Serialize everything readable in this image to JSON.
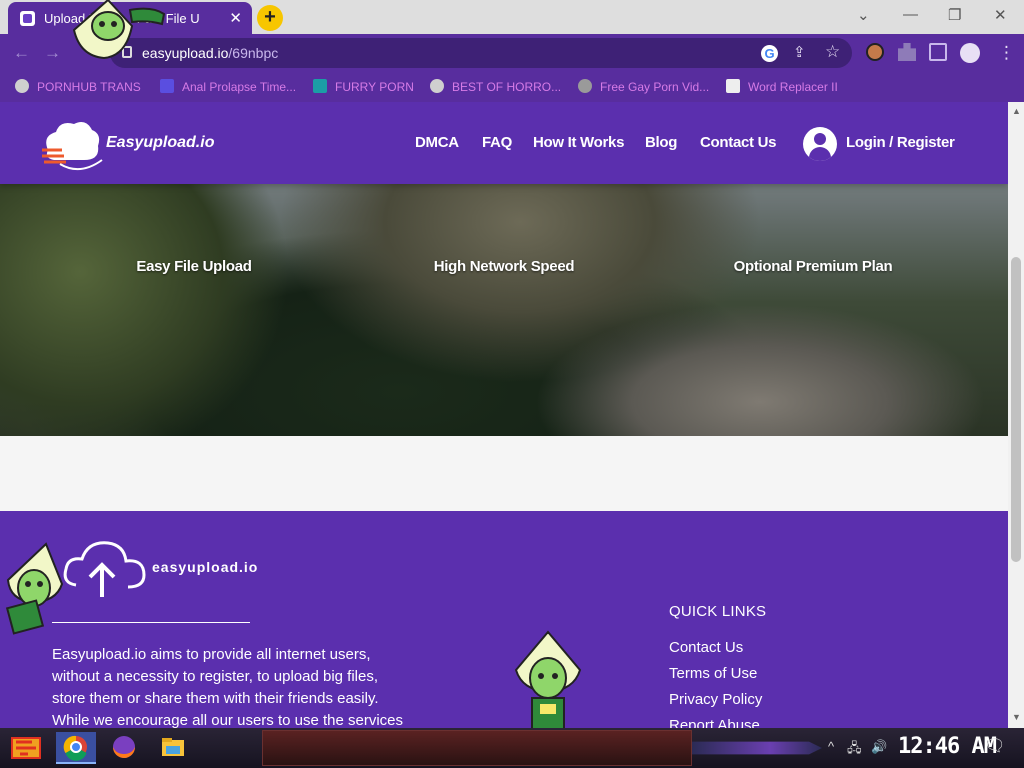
{
  "browser": {
    "tab_title": "Upload Files Fast File U",
    "tab_title_visible": "Upload F",
    "tab_title_visible_right": "Fast File U",
    "tab_close": "✕",
    "new_tab": "+",
    "window_controls": {
      "minimize": "—",
      "restore": "❐",
      "close": "✕",
      "tabsearch": "⌄"
    },
    "url_host": "easyupload.io",
    "url_path": "/69nbpc",
    "back": "←",
    "forward": "→",
    "reload": "C",
    "bookmarks": [
      {
        "label": "PORNHUB TRANS"
      },
      {
        "label": "Anal Prolapse Time..."
      },
      {
        "label": "FURRY PORN"
      },
      {
        "label": "BEST OF HORRO..."
      },
      {
        "label": "Free Gay Porn Vid..."
      },
      {
        "label": "Word Replacer II"
      }
    ]
  },
  "header": {
    "logo": "Easyupload.io",
    "nav": [
      "DMCA",
      "FAQ",
      "How It Works",
      "Blog",
      "Contact Us"
    ],
    "login": "Login / Register"
  },
  "features": [
    {
      "label": "Easy File Upload"
    },
    {
      "label": "High Network Speed"
    },
    {
      "label": "Optional Premium Plan"
    }
  ],
  "footer": {
    "logo": "easyupload.io",
    "about_lines": [
      "Easyupload.io aims to provide all internet users,",
      "without a necessity to register, to upload big files,",
      "store them or share them with their friends easily.",
      "While we encourage all our users to use the services"
    ],
    "quick_links_title": "QUICK LINKS",
    "quick_links": [
      "Contact Us",
      "Terms of Use",
      "Privacy Policy",
      "Report Abuse"
    ]
  },
  "taskbar": {
    "clock": "12:46 AM"
  },
  "colors": {
    "purple": "#5b2fae",
    "chrome_purple": "#582d9e",
    "bookmark_text": "#d67be6"
  }
}
